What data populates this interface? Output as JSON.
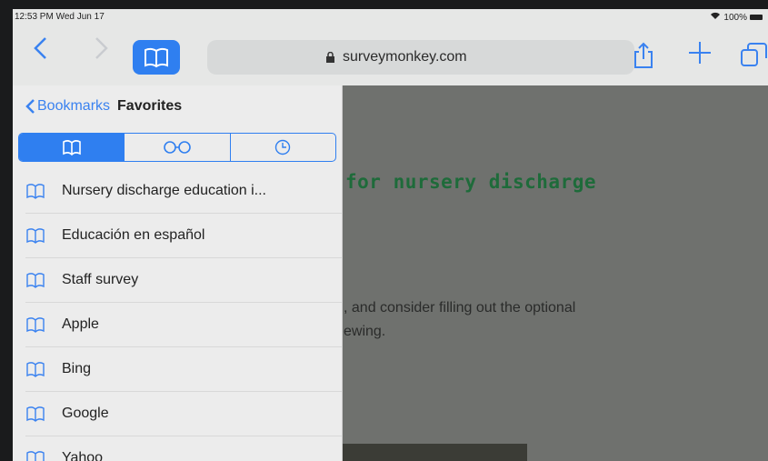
{
  "status": {
    "time": "12:53 PM  Wed Jun 17",
    "battery": "100%"
  },
  "toolbar": {
    "url": "surveymonkey.com"
  },
  "sidebar": {
    "back_label": "Bookmarks",
    "title": "Favorites",
    "tabs": [
      {
        "icon": "book-icon",
        "active": true
      },
      {
        "icon": "reading-list-glasses-icon",
        "active": false
      },
      {
        "icon": "history-clock-icon",
        "active": false
      }
    ],
    "items": [
      {
        "label": "Nursery discharge education i..."
      },
      {
        "label": "Educación en español"
      },
      {
        "label": "Staff survey"
      },
      {
        "label": "Apple"
      },
      {
        "label": "Bing"
      },
      {
        "label": "Google"
      },
      {
        "label": "Yahoo"
      }
    ]
  },
  "content": {
    "headline": "for nursery discharge",
    "body_line1": ", and consider filling out the optional",
    "body_line2": "ewing."
  },
  "colors": {
    "accent": "#2f7ff0",
    "headline": "#1e6b3a"
  }
}
